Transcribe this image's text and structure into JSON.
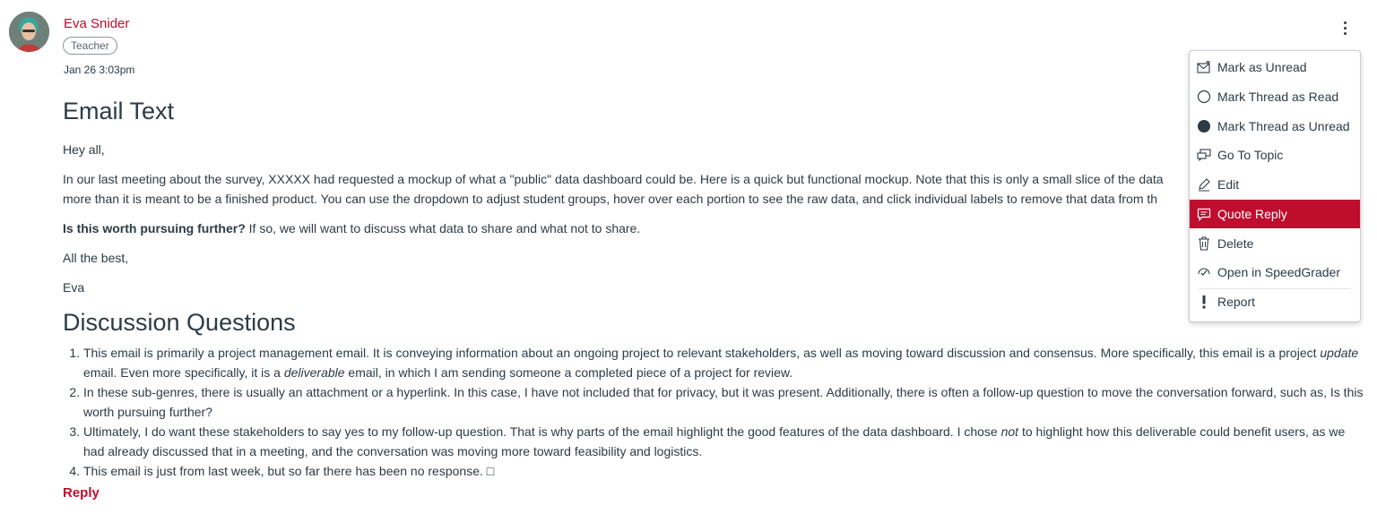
{
  "author": {
    "name": "Eva Snider",
    "role": "Teacher",
    "date": "Jan 26 3:03pm"
  },
  "post": {
    "title": "Email Text",
    "greeting": "Hey all,",
    "intro_line1": "In our last meeting about the survey, XXXXX had requested a mockup of what a \"public\" data dashboard could be. Here is a quick but functional mockup. Note that this is only a small slice of the data",
    "intro_line2": "more than it is meant to be a finished product. You can use the dropdown to adjust student groups, hover over each portion to see the raw data, and click individual labels to remove that data from th",
    "question_bold": "Is this worth pursuing further?",
    "question_rest": " If so, we will want to discuss what data to share and what not to share.",
    "closing": "All the best,",
    "signature": "Eva"
  },
  "discussion": {
    "title": "Discussion Questions",
    "items": [
      {
        "a": "This email is primarily a project management email. It is conveying information about an ongoing project to relevant stakeholders, as well as moving toward discussion and consensus. More specifically, this email is a project ",
        "em1": "update",
        "b": " email. Even more specifically, it is a ",
        "em2": "deliverable",
        "c": " email, in which I am sending someone a completed piece of a project for review."
      },
      {
        "text": "In these sub-genres, there is usually an attachment or a hyperlink. In this case, I have not included that for privacy, but it was present. Additionally, there is often a follow-up question to move the conversation forward, such as, Is this worth pursuing further?"
      },
      {
        "a": "Ultimately, I do want these stakeholders to say yes to my follow-up question. That is why parts of the email highlight the good features of the data dashboard. I chose ",
        "em1": "not",
        "b": " to highlight how this deliverable could benefit users, as we had already discussed that in a meeting, and the conversation was moving more toward feasibility and logistics."
      },
      {
        "text": "This email is just from last week, but so far there has been no response. □"
      }
    ]
  },
  "reply_label": "Reply",
  "menu": {
    "items": [
      {
        "label": "Mark as Unread",
        "icon": "mail-icon"
      },
      {
        "label": "Mark Thread as Read",
        "icon": "circle-outline-icon"
      },
      {
        "label": "Mark Thread as Unread",
        "icon": "circle-filled-icon"
      },
      {
        "label": "Go To Topic",
        "icon": "discussion-icon"
      },
      {
        "label": "Edit",
        "icon": "pencil-icon"
      },
      {
        "label": "Quote Reply",
        "icon": "quote-icon",
        "active": true
      },
      {
        "label": "Delete",
        "icon": "trash-icon"
      },
      {
        "label": "Open in SpeedGrader",
        "icon": "speedgrader-icon"
      },
      {
        "label": "Report",
        "icon": "exclamation-icon"
      }
    ]
  },
  "colors": {
    "accent": "#bf0d2e",
    "text": "#2d3b45"
  }
}
